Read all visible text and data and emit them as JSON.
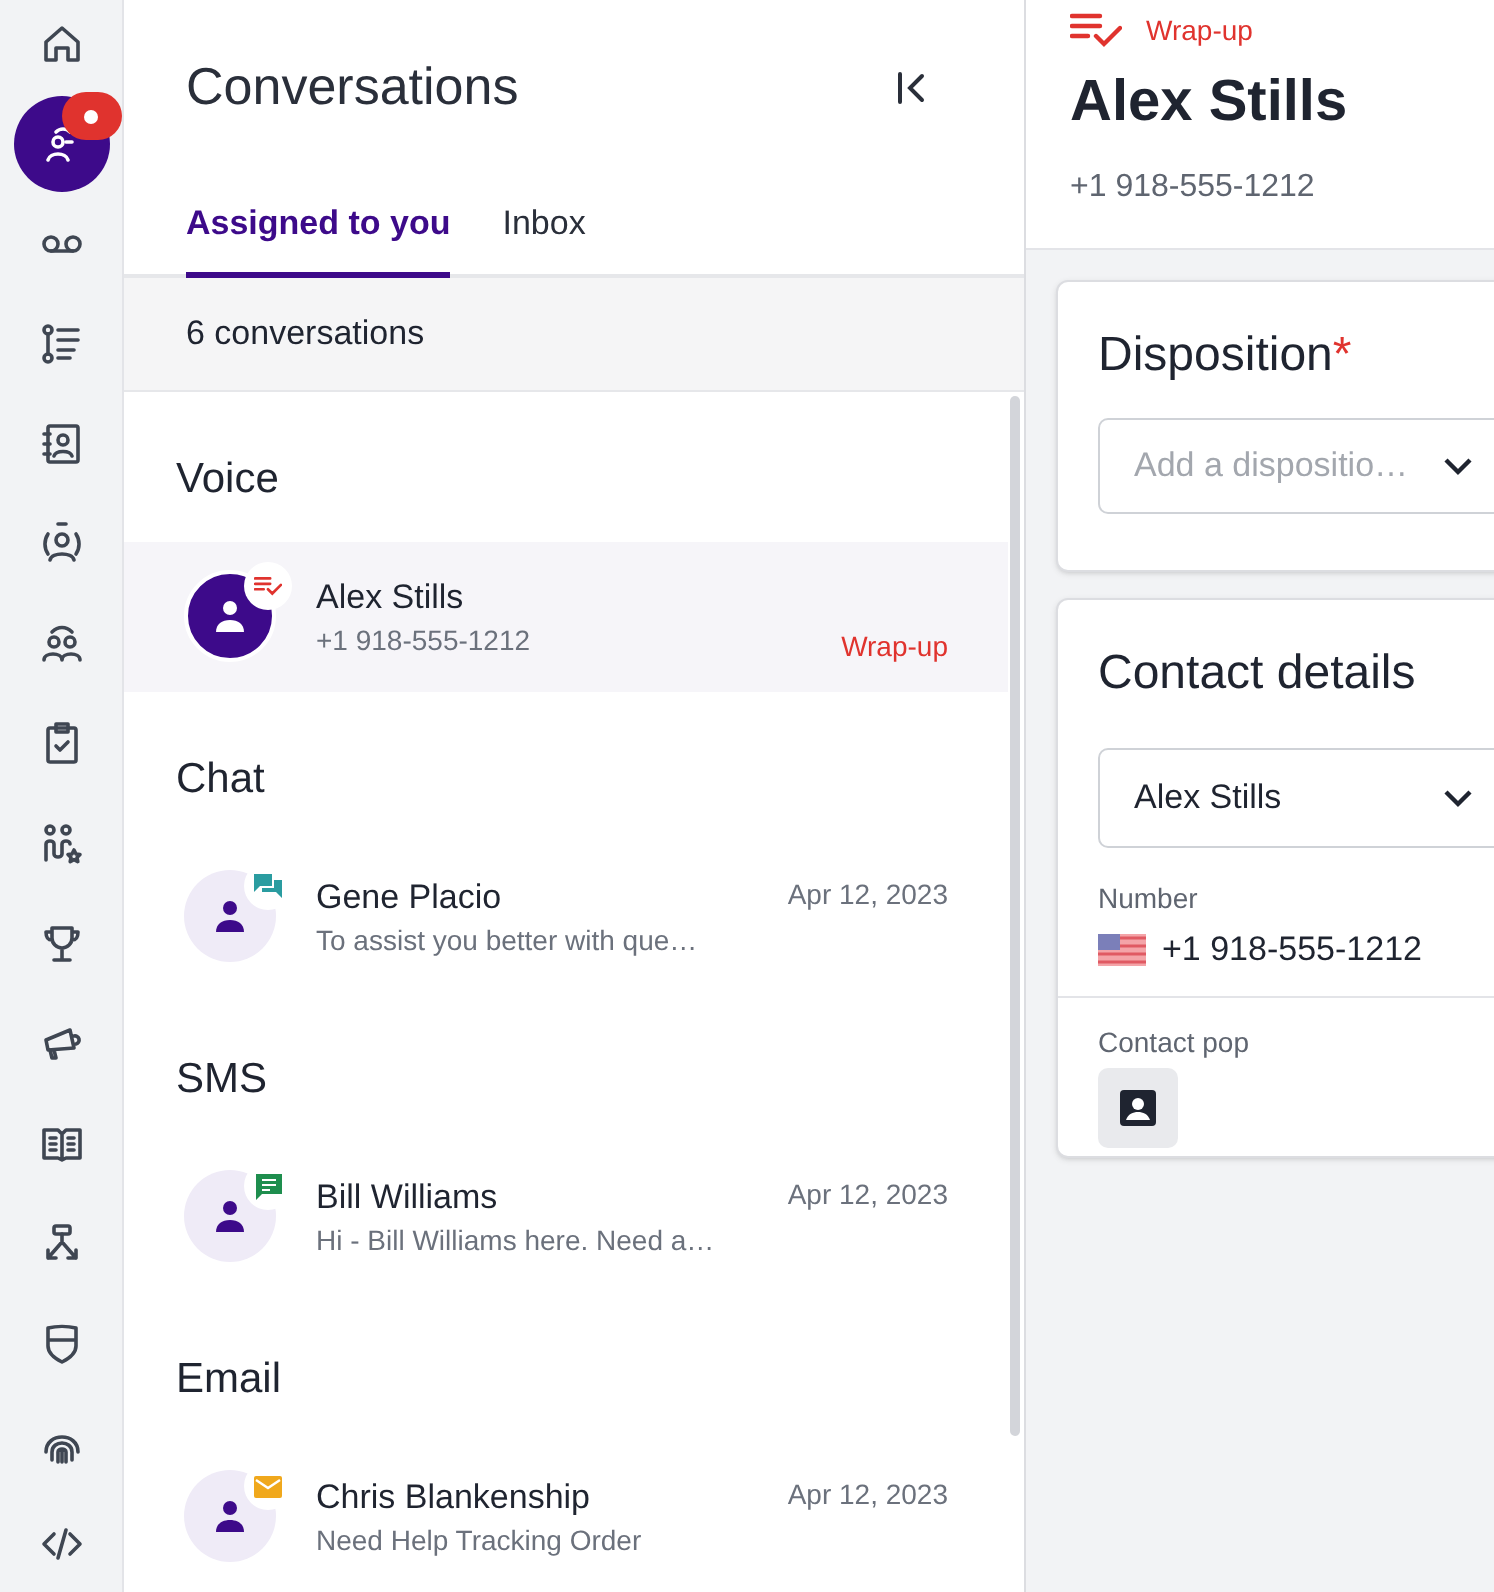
{
  "nav_rail": [
    {
      "kind": "home",
      "selected": false,
      "notification": false
    },
    {
      "kind": "agent",
      "selected": true,
      "notification": true
    },
    {
      "kind": "voicemail",
      "selected": false,
      "notification": false
    },
    {
      "kind": "steps",
      "selected": false,
      "notification": false
    },
    {
      "kind": "contacts",
      "selected": false,
      "notification": false
    },
    {
      "kind": "person-circle",
      "selected": false,
      "notification": false
    },
    {
      "kind": "people",
      "selected": false,
      "notification": false
    },
    {
      "kind": "clipboard",
      "selected": false,
      "notification": false
    },
    {
      "kind": "people-star",
      "selected": false,
      "notification": false
    },
    {
      "kind": "trophy",
      "selected": false,
      "notification": false
    },
    {
      "kind": "megaphone",
      "selected": false,
      "notification": false
    },
    {
      "kind": "book",
      "selected": false,
      "notification": false
    },
    {
      "kind": "flow",
      "selected": false,
      "notification": false
    },
    {
      "kind": "shield",
      "selected": false,
      "notification": false
    },
    {
      "kind": "fingerprint",
      "selected": false,
      "notification": false
    },
    {
      "kind": "code",
      "selected": false,
      "notification": false
    }
  ],
  "conversations": {
    "title": "Conversations",
    "tabs": [
      {
        "label": "Assigned to you",
        "selected": true
      },
      {
        "label": "Inbox",
        "selected": false
      }
    ],
    "count": "6 conversations",
    "sections": [
      {
        "heading": "Voice",
        "items": [
          {
            "kind": "voice",
            "selected": true,
            "name": "Alex Stills",
            "subtitle": "+1 918-555-1212",
            "status": "Wrap-up"
          }
        ]
      },
      {
        "heading": "Chat",
        "items": [
          {
            "kind": "chat",
            "selected": false,
            "name": "Gene Placio",
            "subtitle": "To assist you better with que…",
            "date": "Apr 12, 2023"
          }
        ]
      },
      {
        "heading": "SMS",
        "items": [
          {
            "kind": "sms",
            "selected": false,
            "name": "Bill Williams",
            "subtitle": "Hi - Bill Williams here. Need a…",
            "date": "Apr 12, 2023"
          }
        ]
      },
      {
        "heading": "Email",
        "items": [
          {
            "kind": "email",
            "selected": false,
            "name": "Chris Blankenship",
            "subtitle": "Need Help Tracking Order",
            "date": "Apr 12, 2023"
          }
        ]
      }
    ]
  },
  "detail": {
    "status": "Wrap-up",
    "name": "Alex Stills",
    "phone": "+1 918-555-1212",
    "disposition": {
      "title": "Disposition",
      "required_mark": "*",
      "placeholder": "Add a dispositio…"
    },
    "contact_details": {
      "title": "Contact details",
      "contact": "Alex Stills",
      "number_label": "Number",
      "number": "+1 918-555-1212",
      "contact_pop_label": "Contact pop"
    }
  }
}
